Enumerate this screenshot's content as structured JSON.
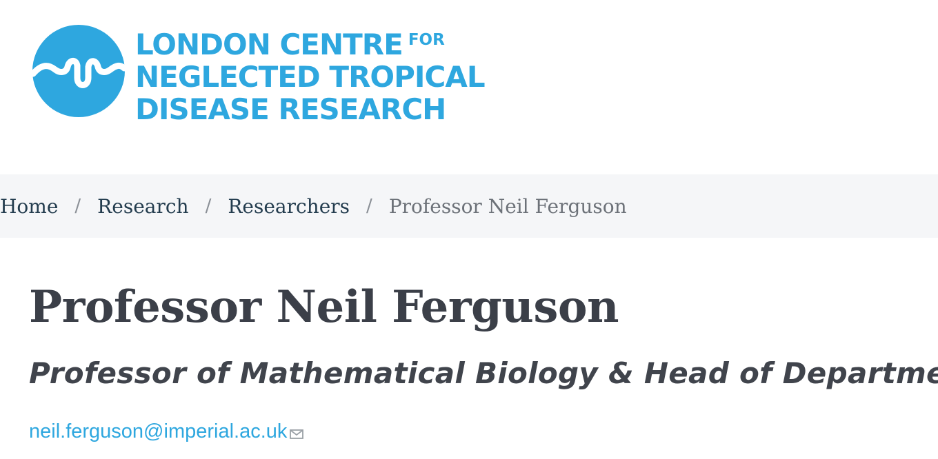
{
  "logo": {
    "line1": "LONDON CENTRE",
    "line1_suffix": "FOR",
    "line2": "NEGLECTED TROPICAL",
    "line3": "DISEASE RESEARCH",
    "color": "#2ea7df"
  },
  "breadcrumb": {
    "items": [
      {
        "label": "Home"
      },
      {
        "label": "Research"
      },
      {
        "label": "Researchers"
      }
    ],
    "separator": "/",
    "current": "Professor Neil Ferguson"
  },
  "profile": {
    "name": "Professor Neil Ferguson",
    "role": "Professor of Mathematical Biology & Head of Department",
    "email": "neil.ferguson@imperial.ac.uk",
    "email_icon": "mail-icon"
  }
}
